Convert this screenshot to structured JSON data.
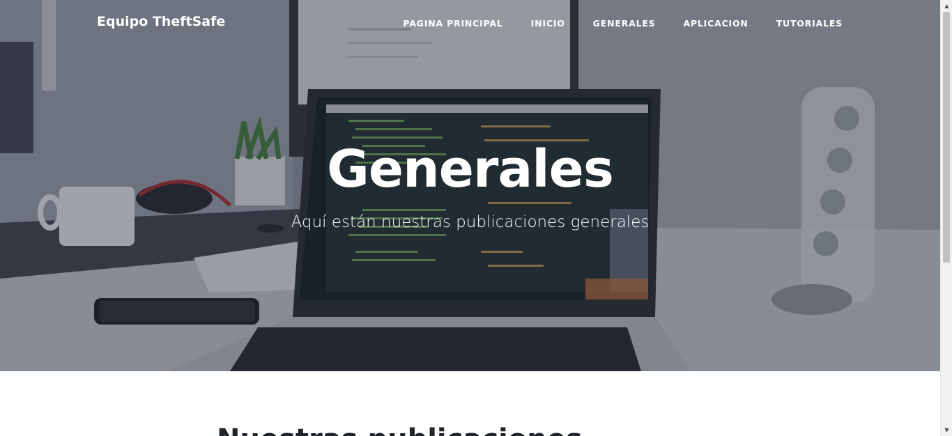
{
  "navbar": {
    "brand": "Equipo TheftSafe",
    "links": [
      {
        "label": "PAGINA PRINCIPAL"
      },
      {
        "label": "INICIO"
      },
      {
        "label": "GENERALES"
      },
      {
        "label": "APLICACION"
      },
      {
        "label": "TUTORIALES"
      }
    ]
  },
  "hero": {
    "title": "Generales",
    "subtitle": "Aquí están nuestras publicaciones generales",
    "background_image": "laptop-desk-photo"
  },
  "section": {
    "heading": "Nuestras publicaciones"
  },
  "scrollbar": {
    "up_icon": "chevron-up-icon",
    "down_icon": "chevron-down-icon"
  }
}
